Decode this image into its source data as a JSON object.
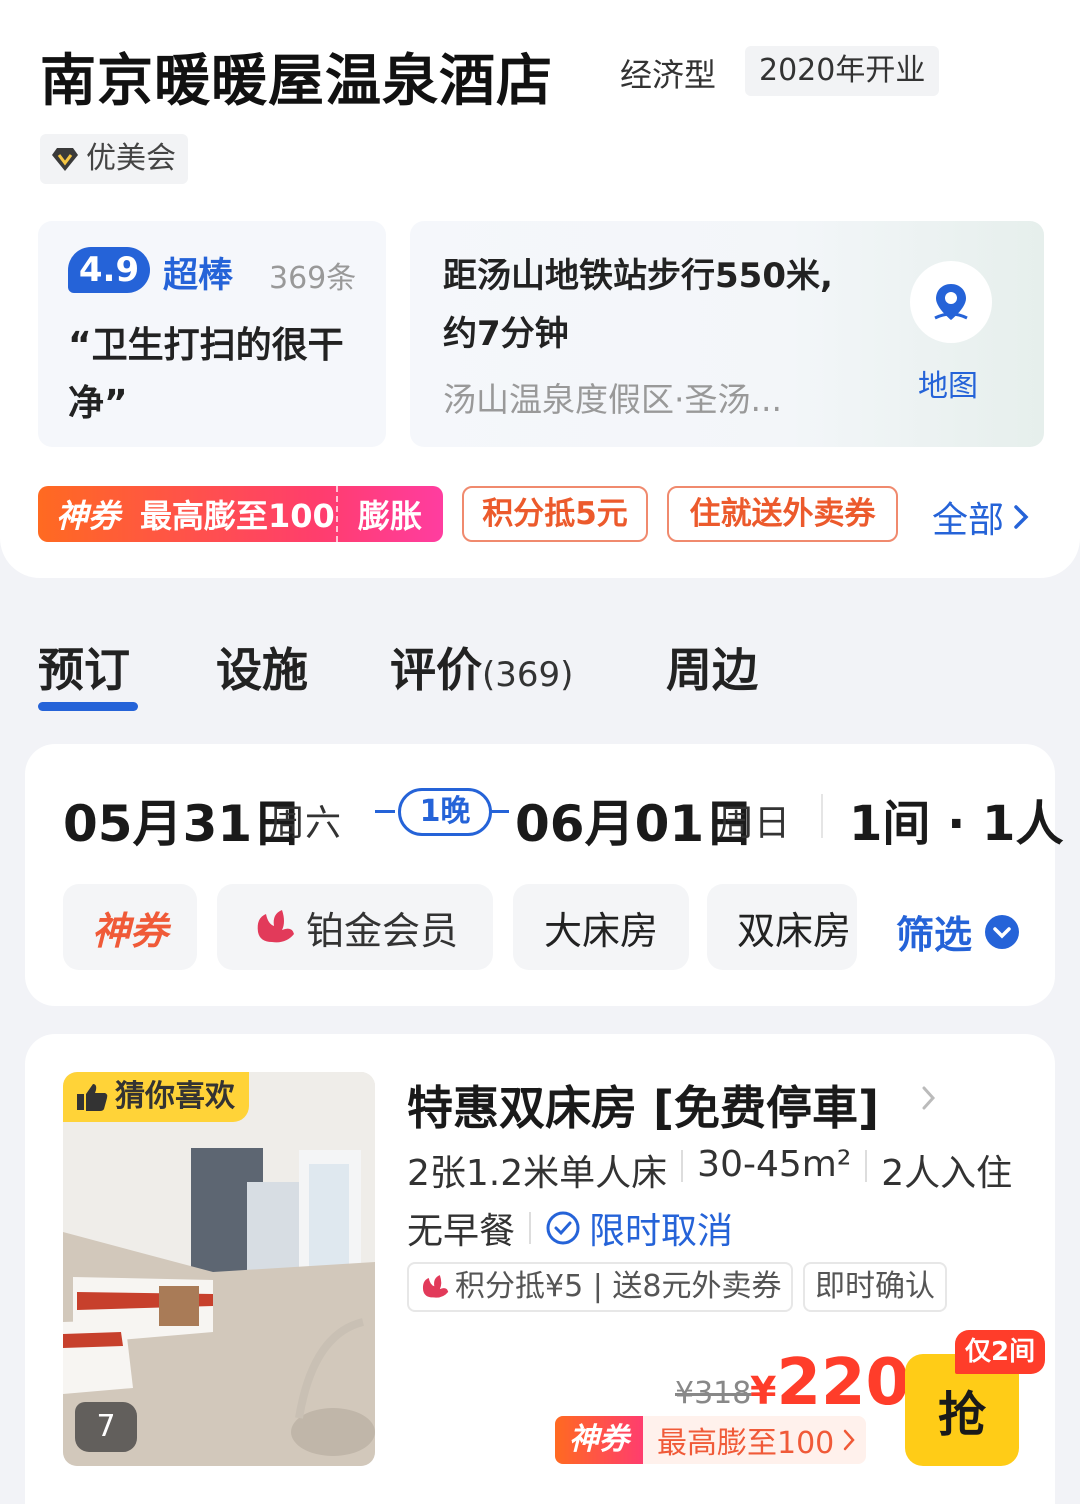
{
  "hotel": {
    "name": "南京暖暖屋温泉酒店",
    "type": "经济型",
    "opened": "2020年开业",
    "membership": "优美会"
  },
  "rating": {
    "score": "4.9",
    "word": "超棒",
    "count": "369条",
    "quote": "“卫生打扫的很干净”"
  },
  "location": {
    "distance": "距汤山地铁站步行550米,约7分钟",
    "area": "汤山温泉度假区·圣汤...",
    "map_label": "地图"
  },
  "promos": {
    "shen_label": "神券",
    "max_label": "最高膨至100",
    "expand_label": "膨胀",
    "points_label": "积分抵5元",
    "takeout_label": "住就送外卖券",
    "all_label": "全部"
  },
  "tabs": [
    {
      "label": "预订",
      "count": ""
    },
    {
      "label": "设施",
      "count": ""
    },
    {
      "label": "评价",
      "count": "(369)"
    },
    {
      "label": "周边",
      "count": ""
    }
  ],
  "booking": {
    "checkin_date": "05月31日",
    "checkin_week": "周六",
    "nights": "1晚",
    "checkout_date": "06月01日",
    "checkout_week": "周日",
    "rooms_people": "1间 · 1人"
  },
  "filters": {
    "chips": [
      "神券",
      "铂金会员",
      "大床房",
      "双床房"
    ],
    "filter_label": "筛选"
  },
  "room": {
    "tag": "猜你喜欢",
    "photo_count": "7",
    "title": "特惠双床房 [免费停車]",
    "beds": "2张1.2米单人床",
    "area": "30-45m²",
    "occupancy": "2人入住",
    "breakfast": "无早餐",
    "cancel": "限时取消",
    "benefit": "积分抵¥5 | 送8元外卖券",
    "confirm": "即时确认",
    "orig_price": "¥318",
    "price_symbol": "¥",
    "price": "220",
    "coupon_shen": "神券",
    "coupon_text": "最高膨至100",
    "grab_label": "抢",
    "stock_label": "仅2间"
  },
  "colors": {
    "accent_blue": "#2563d8",
    "price_red": "#ff3d2a",
    "grab_yellow": "#ffcc17",
    "promo_orange": "#ec5a2c"
  }
}
